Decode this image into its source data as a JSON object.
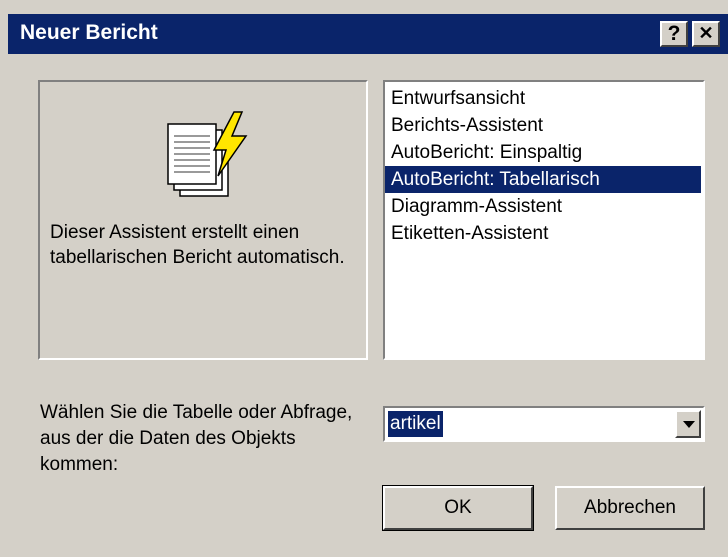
{
  "window": {
    "title": "Neuer Bericht",
    "help_label": "?",
    "close_label": "✕"
  },
  "preview": {
    "icon": "report-wizard-icon",
    "description": "Dieser Assistent erstellt einen tabellarischen Bericht automatisch."
  },
  "report_types": {
    "items": [
      "Entwurfsansicht",
      "Berichts-Assistent",
      "AutoBericht: Einspaltig",
      "AutoBericht: Tabellarisch",
      "Diagramm-Assistent",
      "Etiketten-Assistent"
    ],
    "selected_index": 3
  },
  "source": {
    "prompt": "Wählen Sie die Tabelle oder Abfrage, aus der die Daten des Objekts kommen:",
    "value": "artikel"
  },
  "buttons": {
    "ok_label": "OK",
    "cancel_label": "Abbrechen"
  },
  "colors": {
    "titlebar": "#0a246a",
    "face": "#d4d0c8",
    "selection": "#0a246a"
  }
}
